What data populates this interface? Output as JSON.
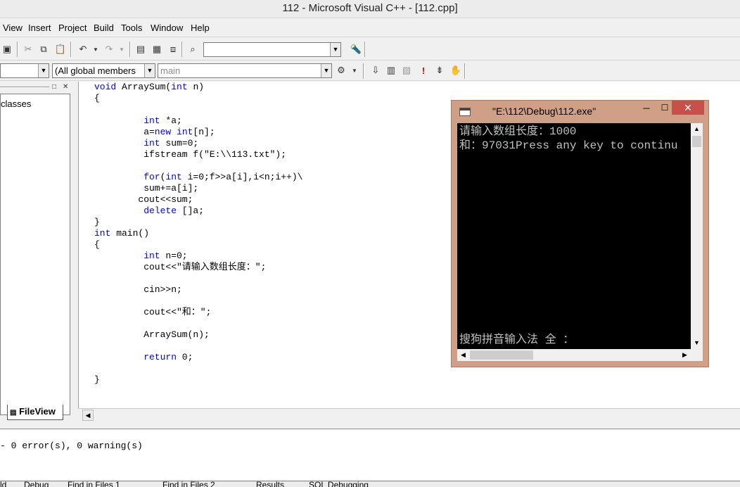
{
  "window": {
    "title": "112 - Microsoft Visual C++ - [112.cpp]"
  },
  "menu": [
    "View",
    "Insert",
    "Project",
    "Build",
    "Tools",
    "Window",
    "Help"
  ],
  "toolbar": {
    "find_value": "",
    "icons": [
      "save-all-icon",
      "cut-icon",
      "copy-icon",
      "paste-icon",
      "undo-icon",
      "redo-icon",
      "workspace-icon",
      "output-icon",
      "windows-list-icon",
      "find-in-files-icon",
      "search-icon"
    ]
  },
  "wizardbar": {
    "class_value": "",
    "filter_value": "(All global members",
    "member_value": "main",
    "icons": [
      "action-icon",
      "compile-icon",
      "build-icon",
      "stop-build-icon",
      "execute-icon",
      "go-icon",
      "breakpoint-icon"
    ]
  },
  "workspace": {
    "tree_label": "classes",
    "fileview_tab": "FileView"
  },
  "code": [
    {
      "t": "void ArraySum(int n)",
      "k": [
        "void",
        "int"
      ],
      "i": 0
    },
    {
      "t": "{",
      "k": [],
      "i": 0
    },
    {
      "t": "",
      "k": [],
      "i": 0
    },
    {
      "t": "int *a;",
      "k": [
        "int"
      ],
      "i": 9
    },
    {
      "t": "a=new int[n];",
      "k": [
        "new",
        "int"
      ],
      "i": 9
    },
    {
      "t": "int sum=0;",
      "k": [
        "int"
      ],
      "i": 9
    },
    {
      "t": "ifstream f(\"E:\\\\113.txt\");",
      "k": [],
      "i": 9
    },
    {
      "t": "",
      "k": [],
      "i": 0
    },
    {
      "t": "for(int i=0;f>>a[i],i<n;i++)\\",
      "k": [
        "for",
        "int"
      ],
      "i": 9
    },
    {
      "t": "sum+=a[i];",
      "k": [],
      "i": 9
    },
    {
      "t": "cout<<sum;",
      "k": [],
      "i": 8
    },
    {
      "t": "delete []a;",
      "k": [
        "delete"
      ],
      "i": 9
    },
    {
      "t": "}",
      "k": [],
      "i": 0
    },
    {
      "t": "int main()",
      "k": [
        "int"
      ],
      "i": 0
    },
    {
      "t": "{",
      "k": [],
      "i": 0
    },
    {
      "t": "int n=0;",
      "k": [
        "int"
      ],
      "i": 9
    },
    {
      "t": "cout<<\"请输入数组长度：\";",
      "k": [],
      "i": 9
    },
    {
      "t": "",
      "k": [],
      "i": 0
    },
    {
      "t": "cin>>n;",
      "k": [],
      "i": 9
    },
    {
      "t": "",
      "k": [],
      "i": 0
    },
    {
      "t": "cout<<\"和：\";",
      "k": [],
      "i": 9
    },
    {
      "t": "",
      "k": [],
      "i": 0
    },
    {
      "t": "ArraySum(n);",
      "k": [],
      "i": 9
    },
    {
      "t": "",
      "k": [],
      "i": 0
    },
    {
      "t": "return 0;",
      "k": [
        "return"
      ],
      "i": 9
    },
    {
      "t": "",
      "k": [],
      "i": 0
    },
    {
      "t": "}",
      "k": [],
      "i": 0
    }
  ],
  "console": {
    "title": "\"E:\\112\\Debug\\112.exe\"",
    "lines": [
      "请输入数组长度：1000",
      "和：97031Press any key to continu"
    ],
    "ime_status": "搜狗拼音输入法 全 ："
  },
  "output": {
    "line": "- 0 error(s), 0 warning(s)",
    "tabs": [
      "ld",
      "Debug",
      "Find in Files 1",
      "Find in Files 2",
      "Results",
      "SQL Debugging"
    ]
  }
}
